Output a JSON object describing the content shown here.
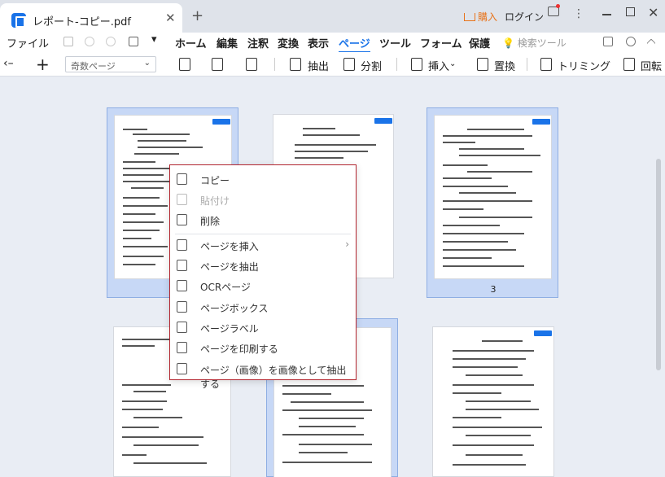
{
  "titlebar": {
    "tab_title": "レポート-コピー.pdf",
    "tab_close": "✕",
    "tab_add": "+",
    "buy_label": "購入",
    "login_label": "ログイン",
    "kebab": "⋮",
    "close": "✕"
  },
  "menubar": {
    "file": "ファイル",
    "items": [
      "ホーム",
      "編集",
      "注釈",
      "変換",
      "表示",
      "ページ",
      "ツール",
      "フォーム",
      "保護"
    ],
    "active": "ページ",
    "search_tools": "検索ツール",
    "dropdown": "▾"
  },
  "toolbar": {
    "back": "‹–",
    "add": "+",
    "page_filter": "奇数ページ",
    "chev": "⌄",
    "extract": "抽出",
    "split": "分割",
    "insert": "挿入",
    "insert_chev": "⌄",
    "replace": "置換",
    "trim": "トリミング",
    "rotate": "回転"
  },
  "pages": [
    {
      "number": "",
      "selected": true
    },
    {
      "number": "",
      "selected": false
    },
    {
      "number": "3",
      "selected": true
    },
    {
      "number": "",
      "selected": false
    },
    {
      "number": "",
      "selected": true
    },
    {
      "number": "",
      "selected": false
    }
  ],
  "context_menu": {
    "items": [
      {
        "label": "コピー",
        "icon": "copy-icon",
        "disabled": false
      },
      {
        "label": "貼付け",
        "icon": "paste-icon",
        "disabled": true
      },
      {
        "label": "削除",
        "icon": "trash-icon",
        "disabled": false
      },
      {
        "label": "ページを挿入",
        "icon": "insert-page-icon",
        "disabled": false,
        "submenu": "›"
      },
      {
        "label": "ページを抽出",
        "icon": "extract-page-icon",
        "disabled": false
      },
      {
        "label": "OCRページ",
        "icon": "ocr-icon",
        "disabled": false
      },
      {
        "label": "ページボックス",
        "icon": "page-box-icon",
        "disabled": false
      },
      {
        "label": "ページラベル",
        "icon": "page-label-icon",
        "disabled": false
      },
      {
        "label": "ページを印刷する",
        "icon": "print-icon",
        "disabled": false
      },
      {
        "label": "ページ（画像）を画像として抽出する",
        "icon": "image-extract-icon",
        "disabled": false
      }
    ]
  },
  "colors": {
    "accent": "#1a73e8",
    "menu_border": "#b32630",
    "selected_page": "#c7d8f6",
    "buy": "#e8731a"
  }
}
